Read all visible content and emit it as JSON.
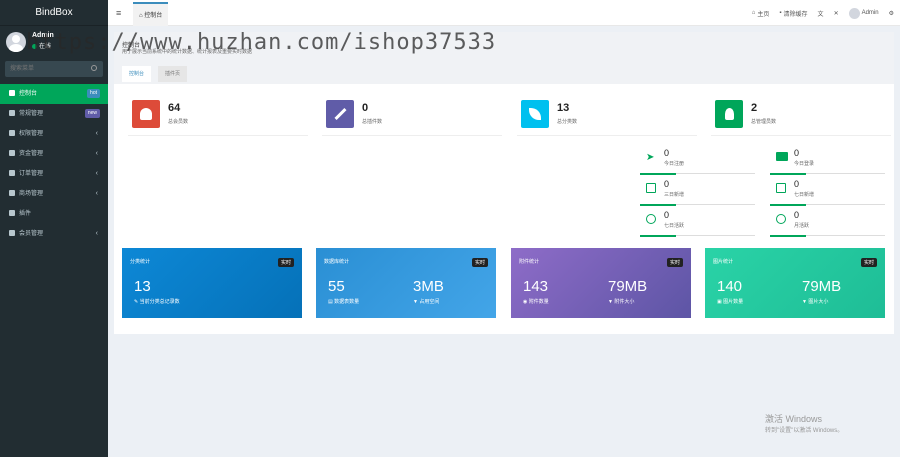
{
  "app": {
    "brand": "BindBox"
  },
  "user": {
    "name": "Admin",
    "status": "在线"
  },
  "search": {
    "placeholder": "搜索菜单"
  },
  "menu": [
    {
      "label": "控制台",
      "badge": "hot",
      "active": true,
      "icon": "dashboard-icon"
    },
    {
      "label": "常规管理",
      "badge": "new",
      "icon": "cogs-icon"
    },
    {
      "label": "权限管理",
      "arrow": "‹",
      "icon": "group-icon"
    },
    {
      "label": "资金管理",
      "arrow": "‹",
      "icon": "gear-icon"
    },
    {
      "label": "订单管理",
      "arrow": "‹",
      "icon": "circle-icon"
    },
    {
      "label": "商场管理",
      "arrow": "‹",
      "icon": "circle-icon"
    },
    {
      "label": "插件",
      "icon": "rocket-icon"
    },
    {
      "label": "会员管理",
      "arrow": "‹",
      "icon": "list-icon"
    }
  ],
  "topbar": {
    "menu_icon": "≡",
    "tab": "控制台",
    "home": "主页",
    "clear_cache": "清除缓存",
    "admin": "Admin"
  },
  "header": {
    "title": "控制台",
    "desc": "用于展示当前系统中的统计数据、统计报表及重要实时数据",
    "tabs": [
      "控制台",
      "插件页"
    ]
  },
  "stats": [
    {
      "value": "64",
      "label": "总会员数",
      "color": "#dd4b39"
    },
    {
      "value": "0",
      "label": "总插件数",
      "color": "#605ca8"
    },
    {
      "value": "13",
      "label": "总分类数",
      "color": "#00c0ef"
    },
    {
      "value": "2",
      "label": "总管理员数",
      "color": "#00a65a"
    }
  ],
  "small_stats": [
    {
      "value": "0",
      "label": "今日注册"
    },
    {
      "value": "0",
      "label": "今日登录"
    },
    {
      "value": "0",
      "label": "三日新增"
    },
    {
      "value": "0",
      "label": "七日新增"
    },
    {
      "value": "0",
      "label": "七日活跃"
    },
    {
      "value": "0",
      "label": "月活跃"
    }
  ],
  "cards": [
    {
      "title": "分类统计",
      "badge": "实时",
      "v1": "13",
      "l1": "当前分类总记录数",
      "v2": "",
      "l2": ""
    },
    {
      "title": "数据库统计",
      "badge": "实时",
      "v1": "55",
      "l1": "数据表数量",
      "v2": "3MB",
      "l2": "占用空间"
    },
    {
      "title": "附件统计",
      "badge": "实时",
      "v1": "143",
      "l1": "附件数量",
      "v2": "79MB",
      "l2": "附件大小"
    },
    {
      "title": "图片统计",
      "badge": "实时",
      "v1": "140",
      "l1": "图片数量",
      "v2": "79MB",
      "l2": "图片大小"
    }
  ],
  "watermark": {
    "url": "https://www.huzhan.com/ishop37533",
    "win1": "激活 Windows",
    "win2": "转到\"设置\"以激活 Windows。"
  }
}
